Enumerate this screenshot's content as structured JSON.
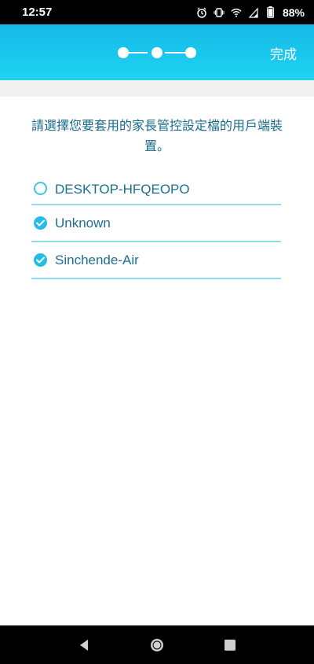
{
  "status_bar": {
    "time": "12:57",
    "battery_percent": "88%",
    "icons": [
      "alarm-icon",
      "vibrate-icon",
      "wifi-icon",
      "signal-icon",
      "battery-icon"
    ]
  },
  "header": {
    "done_label": "完成",
    "steps_total": 3,
    "steps_completed": 3,
    "accent_color": "#1ec6ec"
  },
  "instruction": "請選擇您要套用的家長管控設定檔的用戶端裝置。",
  "devices": [
    {
      "name": "DESKTOP-HFQEOPO",
      "selected": false
    },
    {
      "name": "Unknown",
      "selected": true
    },
    {
      "name": "Sinchende-Air",
      "selected": true
    }
  ],
  "nav": {
    "icons": [
      "back-icon",
      "home-icon",
      "recents-icon"
    ]
  }
}
